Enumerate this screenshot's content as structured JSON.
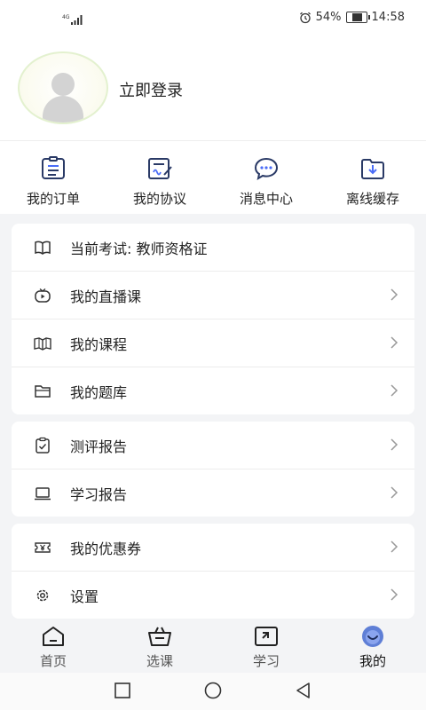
{
  "status_bar": {
    "network": "4G",
    "battery_percent": "54%",
    "battery_level": 0.54,
    "time": "14:58"
  },
  "profile": {
    "login_text": "立即登录"
  },
  "quick_actions": [
    {
      "label": "我的订单",
      "icon": "order-list-icon"
    },
    {
      "label": "我的协议",
      "icon": "agreement-sign-icon"
    },
    {
      "label": "消息中心",
      "icon": "message-bubble-icon"
    },
    {
      "label": "离线缓存",
      "icon": "download-folder-icon"
    }
  ],
  "menu_group_1": [
    {
      "label": "当前考试: 教师资格证",
      "icon": "open-book-icon",
      "chevron": false
    },
    {
      "label": "我的直播课",
      "icon": "live-video-icon",
      "chevron": true
    },
    {
      "label": "我的课程",
      "icon": "course-book-icon",
      "chevron": true
    },
    {
      "label": "我的题库",
      "icon": "folder-icon",
      "chevron": true
    }
  ],
  "menu_group_2": [
    {
      "label": "测评报告",
      "icon": "clipboard-check-icon",
      "chevron": true
    },
    {
      "label": "学习报告",
      "icon": "laptop-icon",
      "chevron": true
    }
  ],
  "menu_group_3": [
    {
      "label": "我的优惠券",
      "icon": "coupon-icon",
      "chevron": true
    },
    {
      "label": "设置",
      "icon": "gear-icon",
      "chevron": true
    }
  ],
  "tab_bar": [
    {
      "label": "首页",
      "icon": "home-icon",
      "active": false
    },
    {
      "label": "选课",
      "icon": "basket-icon",
      "active": false
    },
    {
      "label": "学习",
      "icon": "study-icon",
      "active": false
    },
    {
      "label": "我的",
      "icon": "profile-smile-icon",
      "active": true
    }
  ],
  "colors": {
    "accent": "#4a6cf7",
    "background": "#f3f4f6",
    "card": "#ffffff",
    "text": "#222222"
  }
}
